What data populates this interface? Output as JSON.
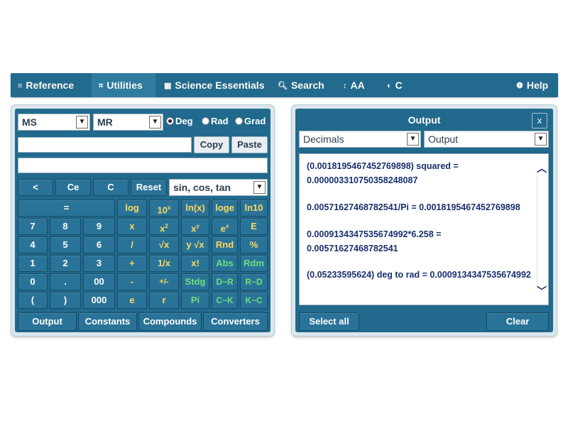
{
  "nav": {
    "items": [
      {
        "icon": "≡",
        "label": "Reference"
      },
      {
        "icon": "⌗",
        "label": "Utilities"
      },
      {
        "icon": "▦",
        "label": "Science Essentials"
      },
      {
        "icon": "🔍︎",
        "label": "Search"
      },
      {
        "icon": "↕",
        "label": "AA"
      },
      {
        "icon": "◐",
        "label": "C"
      },
      {
        "icon": "❶",
        "label": "Help"
      }
    ]
  },
  "calc": {
    "ms_select": "MS",
    "mr_select": "MR",
    "angle_modes": [
      "Deg",
      "Rad",
      "Grad"
    ],
    "selected_mode": "Deg",
    "copy_label": "Copy",
    "paste_label": "Paste",
    "func_select": "sin, cos, tan",
    "buttons": {
      "back": "<",
      "ce": "Ce",
      "c": "C",
      "reset": "Reset",
      "equals": "=",
      "log": "log",
      "ten_x": "10",
      "ten_x_sup": "x",
      "ln": "ln(x)",
      "loge": "loge",
      "ln10": "ln10",
      "n7": "7",
      "n8": "8",
      "n9": "9",
      "mul": "x",
      "x2": "x",
      "x2_sup": "2",
      "xy": "x",
      "xy_sup": "y",
      "ex": "e",
      "ex_sup": "x",
      "E": "E",
      "n4": "4",
      "n5": "5",
      "n6": "6",
      "div": "/",
      "sqrt": "√x",
      "yroot": "y √x",
      "rnd": "Rnd",
      "pct": "%",
      "n1": "1",
      "n2": "2",
      "n3": "3",
      "add": "+",
      "inv": "1/x",
      "fact": "x!",
      "abs": "Abs",
      "rdm": "Rdm",
      "n0": "0",
      "dot": ".",
      "n00": "00",
      "sub": "-",
      "pm": "+/-",
      "stdg": "Stdg",
      "d2r": "D~R",
      "r2d": "R~D",
      "lparen": "(",
      "rparen": ")",
      "n000": "000",
      "e": "e",
      "r": "r",
      "pi": "Pi",
      "c2k": "C~K",
      "k2c": "K~C"
    },
    "bottom_tabs": [
      "Output",
      "Constants",
      "Compounds",
      "Converters"
    ]
  },
  "output": {
    "title": "Output",
    "close": "x",
    "format_select": "Decimals",
    "target_select": "Output",
    "entries": [
      "(0.0018195467452769898) squared = 0.0000033107503582480​87",
      "0.00571627468782541/Pi = 0.0018195467452769898",
      "0.0009134347535674992*6.258 = 0.00571627468782541",
      "(0.05233595624) deg to rad = 0.0009134347535674992"
    ],
    "select_all": "Select all",
    "clear": "Clear"
  },
  "colors": {
    "bar": "#236b8e",
    "button": "#2a7398",
    "green_text": "#6fe07a",
    "yellow_text": "#ffd95c",
    "output_text": "#1a2f6e"
  }
}
